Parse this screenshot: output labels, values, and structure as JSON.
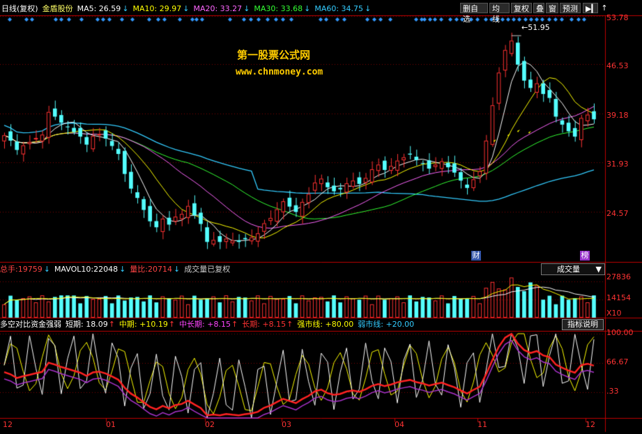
{
  "header": {
    "period_label": "日线(复权)",
    "stock_name": "金盾股份",
    "ma": [
      {
        "label": "MA5:",
        "value": "26.59",
        "color": "#ffffff"
      },
      {
        "label": "MA10:",
        "value": "29.97",
        "color": "#ffff00"
      },
      {
        "label": "MA20:",
        "value": "33.27",
        "color": "#ff66ff"
      },
      {
        "label": "MA30:",
        "value": "33.68",
        "color": "#33ff33"
      },
      {
        "label": "MA60:",
        "value": "34.75",
        "color": "#33ccff"
      }
    ],
    "arrow": "↓"
  },
  "toolbar": {
    "buttons": [
      "删自选",
      "均线",
      "复权",
      "叠",
      "窗",
      "预测"
    ],
    "nav_icon": "play-next-icon",
    "up_icon": "arrow-up-icon"
  },
  "watermark": {
    "line1": "第一股票公式网",
    "line2": "www.chnmoney.com"
  },
  "price_axis": [
    "53.78",
    "46.53",
    "39.18",
    "31.93",
    "24.57"
  ],
  "peak_label": "51.95",
  "markers": {
    "cai": "财",
    "bang": "榜"
  },
  "volume": {
    "total_label": "总手:",
    "total_value": "19759",
    "mavol_label": "MAVOL10:",
    "mavol_value": "22048",
    "ratio_label": "量比:",
    "ratio_value": "20714",
    "note": "成交量已复权",
    "selector": "成交量",
    "axis": [
      "27836",
      "14154"
    ],
    "unit": "X10"
  },
  "indicator": {
    "name": "多空对比资金强弱",
    "items": [
      {
        "label": "短期:",
        "value": "18.09",
        "color": "#ffffff"
      },
      {
        "label": "中期:",
        "value": "+10.19",
        "color": "#ffff00"
      },
      {
        "label": "中长期:",
        "value": "+8.15",
        "color": "#ff44ff"
      },
      {
        "label": "长期:",
        "value": "+8.15",
        "color": "#ff3333"
      },
      {
        "label": "强市线:",
        "value": "+80.00",
        "color": "#ffff00"
      },
      {
        "label": "弱市线:",
        "value": "+20.00",
        "color": "#33ccff"
      }
    ],
    "help_button": "指标说明",
    "axis": [
      "100.00",
      "66.67",
      ".33"
    ]
  },
  "x_axis": [
    "12",
    "01",
    "02",
    "03",
    "04",
    "11",
    "12"
  ],
  "colors": {
    "up": "#ff3232",
    "down": "#54ffff",
    "ma5": "#ffffff",
    "ma10": "#ffff00",
    "ma20": "#ff66ff",
    "ma30": "#33ff33",
    "ma60": "#33ccff",
    "grid": "#800000",
    "axis": "#c00000"
  },
  "chart_data": {
    "type": "candlestick",
    "ylim": [
      18.0,
      55.0
    ],
    "close_series": [
      37.0,
      36.2,
      34.8,
      35.5,
      36.0,
      36.6,
      37.1,
      40.5,
      39.8,
      38.9,
      38.2,
      37.5,
      36.8,
      35.6,
      36.9,
      37.2,
      36.5,
      35.4,
      34.2,
      31.2,
      29.0,
      27.6,
      25.8,
      24.1,
      23.2,
      24.5,
      23.6,
      24.8,
      25.2,
      26.4,
      25.0,
      23.7,
      21.0,
      21.3,
      21.0,
      21.5,
      21.2,
      21.0,
      21.4,
      21.7,
      22.3,
      23.8,
      24.6,
      25.9,
      27.1,
      26.3,
      25.5,
      27.0,
      28.2,
      29.9,
      30.5,
      29.2,
      28.6,
      28.9,
      29.8,
      30.2,
      29.7,
      30.6,
      31.9,
      32.6,
      31.8,
      32.4,
      33.2,
      33.7,
      34.1,
      33.3,
      32.8,
      32.0,
      32.6,
      33.1,
      32.2,
      31.4,
      30.2,
      29.1,
      30.4,
      31.6,
      36.2,
      41.5,
      46.4,
      49.8,
      51.2,
      47.6,
      45.2,
      44.1,
      44.8,
      43.2,
      42.6,
      39.8,
      38.6,
      37.6,
      36.8,
      39.6,
      40.1,
      39.4
    ],
    "volume_note": "daily volume bars share the same dates",
    "indicator_range": [
      0,
      100
    ]
  }
}
